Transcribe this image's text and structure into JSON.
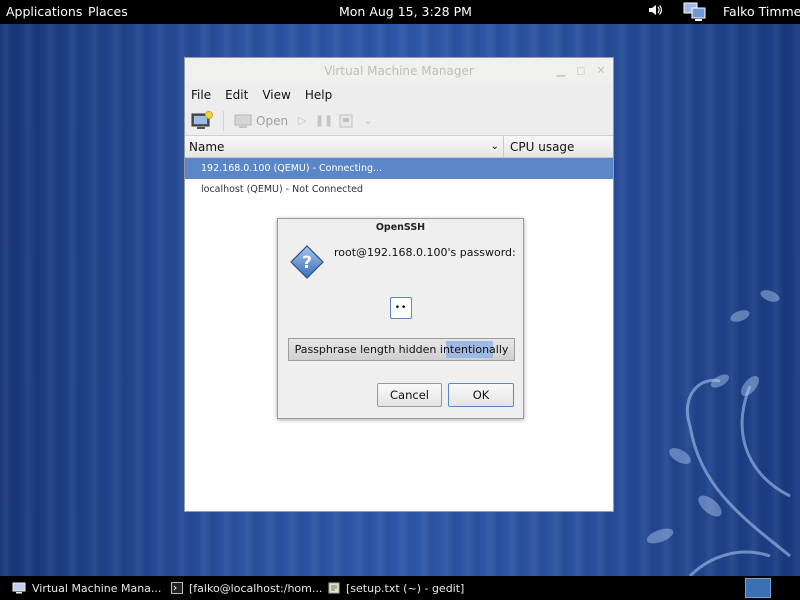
{
  "top_panel": {
    "applications": "Applications",
    "places": "Places",
    "clock": "Mon Aug 15,  3:28 PM",
    "user": "Falko Timme"
  },
  "vmm": {
    "title": "Virtual Machine Manager",
    "menu": [
      "File",
      "Edit",
      "View",
      "Help"
    ],
    "toolbar": {
      "open_label": "Open"
    },
    "columns": {
      "name": "Name",
      "cpu": "CPU usage"
    },
    "rows": [
      {
        "label": "192.168.0.100 (QEMU) - Connecting..."
      },
      {
        "label": "localhost (QEMU) - Not Connected"
      }
    ]
  },
  "dialog": {
    "title": "OpenSSH",
    "prompt": "root@192.168.0.100's password:",
    "password_value": "••",
    "passphrase_note": "Passphrase length hidden intentionally",
    "cancel_label": "Cancel",
    "ok_label": "OK"
  },
  "taskbar": {
    "items": [
      {
        "label": "Virtual Machine Mana..."
      },
      {
        "label": "[falko@localhost:/hom..."
      },
      {
        "label": "[setup.txt (~) - gedit]"
      }
    ]
  },
  "colors": {
    "selection": "#5b86c7",
    "desktop": "#2a52a0"
  }
}
